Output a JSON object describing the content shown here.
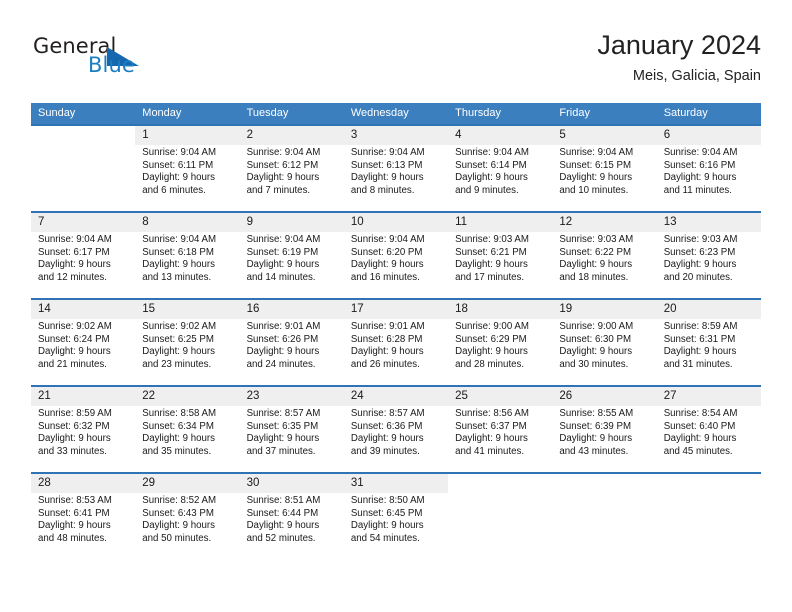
{
  "brand": {
    "name_part1": "General",
    "name_part2": "Blue",
    "triangle_color": "#1567ae",
    "blue_color": "#1c7fc3"
  },
  "header": {
    "title": "January 2024",
    "subtitle": "Meis, Galicia, Spain"
  },
  "theme": {
    "header_row_bg": "#3c7fbf",
    "week_separator": "#2e74b5",
    "day_number_bg": "#efefef"
  },
  "weekdays": [
    "Sunday",
    "Monday",
    "Tuesday",
    "Wednesday",
    "Thursday",
    "Friday",
    "Saturday"
  ],
  "weeks": [
    {
      "days": [
        {
          "num": "",
          "sunrise": "",
          "sunset": "",
          "daylight_line1": "",
          "daylight_line2": ""
        },
        {
          "num": "1",
          "sunrise": "Sunrise: 9:04 AM",
          "sunset": "Sunset: 6:11 PM",
          "daylight_line1": "Daylight: 9 hours",
          "daylight_line2": "and 6 minutes."
        },
        {
          "num": "2",
          "sunrise": "Sunrise: 9:04 AM",
          "sunset": "Sunset: 6:12 PM",
          "daylight_line1": "Daylight: 9 hours",
          "daylight_line2": "and 7 minutes."
        },
        {
          "num": "3",
          "sunrise": "Sunrise: 9:04 AM",
          "sunset": "Sunset: 6:13 PM",
          "daylight_line1": "Daylight: 9 hours",
          "daylight_line2": "and 8 minutes."
        },
        {
          "num": "4",
          "sunrise": "Sunrise: 9:04 AM",
          "sunset": "Sunset: 6:14 PM",
          "daylight_line1": "Daylight: 9 hours",
          "daylight_line2": "and 9 minutes."
        },
        {
          "num": "5",
          "sunrise": "Sunrise: 9:04 AM",
          "sunset": "Sunset: 6:15 PM",
          "daylight_line1": "Daylight: 9 hours",
          "daylight_line2": "and 10 minutes."
        },
        {
          "num": "6",
          "sunrise": "Sunrise: 9:04 AM",
          "sunset": "Sunset: 6:16 PM",
          "daylight_line1": "Daylight: 9 hours",
          "daylight_line2": "and 11 minutes."
        }
      ]
    },
    {
      "days": [
        {
          "num": "7",
          "sunrise": "Sunrise: 9:04 AM",
          "sunset": "Sunset: 6:17 PM",
          "daylight_line1": "Daylight: 9 hours",
          "daylight_line2": "and 12 minutes."
        },
        {
          "num": "8",
          "sunrise": "Sunrise: 9:04 AM",
          "sunset": "Sunset: 6:18 PM",
          "daylight_line1": "Daylight: 9 hours",
          "daylight_line2": "and 13 minutes."
        },
        {
          "num": "9",
          "sunrise": "Sunrise: 9:04 AM",
          "sunset": "Sunset: 6:19 PM",
          "daylight_line1": "Daylight: 9 hours",
          "daylight_line2": "and 14 minutes."
        },
        {
          "num": "10",
          "sunrise": "Sunrise: 9:04 AM",
          "sunset": "Sunset: 6:20 PM",
          "daylight_line1": "Daylight: 9 hours",
          "daylight_line2": "and 16 minutes."
        },
        {
          "num": "11",
          "sunrise": "Sunrise: 9:03 AM",
          "sunset": "Sunset: 6:21 PM",
          "daylight_line1": "Daylight: 9 hours",
          "daylight_line2": "and 17 minutes."
        },
        {
          "num": "12",
          "sunrise": "Sunrise: 9:03 AM",
          "sunset": "Sunset: 6:22 PM",
          "daylight_line1": "Daylight: 9 hours",
          "daylight_line2": "and 18 minutes."
        },
        {
          "num": "13",
          "sunrise": "Sunrise: 9:03 AM",
          "sunset": "Sunset: 6:23 PM",
          "daylight_line1": "Daylight: 9 hours",
          "daylight_line2": "and 20 minutes."
        }
      ]
    },
    {
      "days": [
        {
          "num": "14",
          "sunrise": "Sunrise: 9:02 AM",
          "sunset": "Sunset: 6:24 PM",
          "daylight_line1": "Daylight: 9 hours",
          "daylight_line2": "and 21 minutes."
        },
        {
          "num": "15",
          "sunrise": "Sunrise: 9:02 AM",
          "sunset": "Sunset: 6:25 PM",
          "daylight_line1": "Daylight: 9 hours",
          "daylight_line2": "and 23 minutes."
        },
        {
          "num": "16",
          "sunrise": "Sunrise: 9:01 AM",
          "sunset": "Sunset: 6:26 PM",
          "daylight_line1": "Daylight: 9 hours",
          "daylight_line2": "and 24 minutes."
        },
        {
          "num": "17",
          "sunrise": "Sunrise: 9:01 AM",
          "sunset": "Sunset: 6:28 PM",
          "daylight_line1": "Daylight: 9 hours",
          "daylight_line2": "and 26 minutes."
        },
        {
          "num": "18",
          "sunrise": "Sunrise: 9:00 AM",
          "sunset": "Sunset: 6:29 PM",
          "daylight_line1": "Daylight: 9 hours",
          "daylight_line2": "and 28 minutes."
        },
        {
          "num": "19",
          "sunrise": "Sunrise: 9:00 AM",
          "sunset": "Sunset: 6:30 PM",
          "daylight_line1": "Daylight: 9 hours",
          "daylight_line2": "and 30 minutes."
        },
        {
          "num": "20",
          "sunrise": "Sunrise: 8:59 AM",
          "sunset": "Sunset: 6:31 PM",
          "daylight_line1": "Daylight: 9 hours",
          "daylight_line2": "and 31 minutes."
        }
      ]
    },
    {
      "days": [
        {
          "num": "21",
          "sunrise": "Sunrise: 8:59 AM",
          "sunset": "Sunset: 6:32 PM",
          "daylight_line1": "Daylight: 9 hours",
          "daylight_line2": "and 33 minutes."
        },
        {
          "num": "22",
          "sunrise": "Sunrise: 8:58 AM",
          "sunset": "Sunset: 6:34 PM",
          "daylight_line1": "Daylight: 9 hours",
          "daylight_line2": "and 35 minutes."
        },
        {
          "num": "23",
          "sunrise": "Sunrise: 8:57 AM",
          "sunset": "Sunset: 6:35 PM",
          "daylight_line1": "Daylight: 9 hours",
          "daylight_line2": "and 37 minutes."
        },
        {
          "num": "24",
          "sunrise": "Sunrise: 8:57 AM",
          "sunset": "Sunset: 6:36 PM",
          "daylight_line1": "Daylight: 9 hours",
          "daylight_line2": "and 39 minutes."
        },
        {
          "num": "25",
          "sunrise": "Sunrise: 8:56 AM",
          "sunset": "Sunset: 6:37 PM",
          "daylight_line1": "Daylight: 9 hours",
          "daylight_line2": "and 41 minutes."
        },
        {
          "num": "26",
          "sunrise": "Sunrise: 8:55 AM",
          "sunset": "Sunset: 6:39 PM",
          "daylight_line1": "Daylight: 9 hours",
          "daylight_line2": "and 43 minutes."
        },
        {
          "num": "27",
          "sunrise": "Sunrise: 8:54 AM",
          "sunset": "Sunset: 6:40 PM",
          "daylight_line1": "Daylight: 9 hours",
          "daylight_line2": "and 45 minutes."
        }
      ]
    },
    {
      "days": [
        {
          "num": "28",
          "sunrise": "Sunrise: 8:53 AM",
          "sunset": "Sunset: 6:41 PM",
          "daylight_line1": "Daylight: 9 hours",
          "daylight_line2": "and 48 minutes."
        },
        {
          "num": "29",
          "sunrise": "Sunrise: 8:52 AM",
          "sunset": "Sunset: 6:43 PM",
          "daylight_line1": "Daylight: 9 hours",
          "daylight_line2": "and 50 minutes."
        },
        {
          "num": "30",
          "sunrise": "Sunrise: 8:51 AM",
          "sunset": "Sunset: 6:44 PM",
          "daylight_line1": "Daylight: 9 hours",
          "daylight_line2": "and 52 minutes."
        },
        {
          "num": "31",
          "sunrise": "Sunrise: 8:50 AM",
          "sunset": "Sunset: 6:45 PM",
          "daylight_line1": "Daylight: 9 hours",
          "daylight_line2": "and 54 minutes."
        },
        {
          "num": "",
          "sunrise": "",
          "sunset": "",
          "daylight_line1": "",
          "daylight_line2": ""
        },
        {
          "num": "",
          "sunrise": "",
          "sunset": "",
          "daylight_line1": "",
          "daylight_line2": ""
        },
        {
          "num": "",
          "sunrise": "",
          "sunset": "",
          "daylight_line1": "",
          "daylight_line2": ""
        }
      ]
    }
  ]
}
